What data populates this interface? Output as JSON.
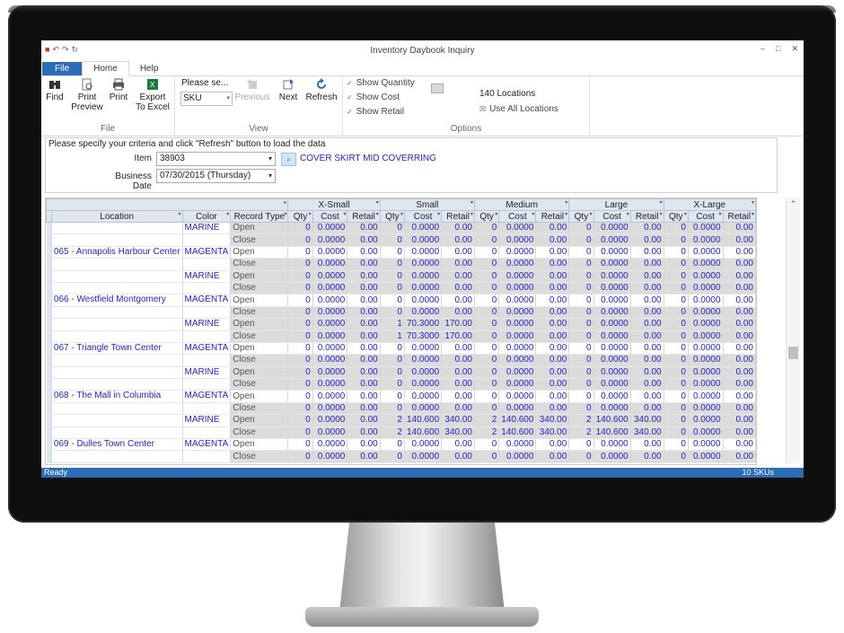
{
  "window": {
    "title": "Inventory Daybook Inquiry"
  },
  "tabs": [
    {
      "label": "File"
    },
    {
      "label": "Home"
    },
    {
      "label": "Help"
    }
  ],
  "ribbon": {
    "file_group": {
      "label": "File",
      "find": "Find",
      "print_preview": "Print Preview",
      "print": "Print",
      "export": "Export To Excel"
    },
    "view_group": {
      "label": "View",
      "please_select": "Please se...",
      "sku_value": "SKU",
      "previous": "Previous",
      "next": "Next",
      "refresh": "Refresh"
    },
    "options_group": {
      "label": "Options",
      "show_quantity": "Show Quantity",
      "show_cost": "Show Cost",
      "show_retail": "Show Retail",
      "locations_count": "140 Locations",
      "use_all_locations": "Use All Locations"
    }
  },
  "criteria": {
    "hint": "Please specify your criteria and click \"Refresh\" button to load the data",
    "item_label": "Item",
    "item_value": "38903",
    "item_description": "COVER SKIRT MID COVERRING",
    "date_label": "Business Date",
    "date_value": "07/30/2015 (Thursday)"
  },
  "grid": {
    "headers": {
      "location": "Location",
      "color": "Color",
      "record_type": "Record Type",
      "qty": "Qty",
      "cost": "Cost",
      "retail": "Retail"
    },
    "sizes": [
      "X-Small",
      "Small",
      "Medium",
      "Large",
      "X-Large"
    ],
    "rows": [
      {
        "loc": "",
        "color": "MARINE",
        "rt": "Open",
        "v": [
          [
            "0",
            "0.0000",
            "0.00"
          ],
          [
            "0",
            "0.0000",
            "0.00"
          ],
          [
            "0",
            "0.0000",
            "0.00"
          ],
          [
            "0",
            "0.0000",
            "0.00"
          ],
          [
            "0",
            "0.0000",
            "0.00"
          ]
        ]
      },
      {
        "loc": "",
        "color": "",
        "rt": "Close",
        "v": [
          [
            "0",
            "0.0000",
            "0.00"
          ],
          [
            "0",
            "0.0000",
            "0.00"
          ],
          [
            "0",
            "0.0000",
            "0.00"
          ],
          [
            "0",
            "0.0000",
            "0.00"
          ],
          [
            "0",
            "0.0000",
            "0.00"
          ]
        ]
      },
      {
        "loc": "065 - Annapolis Harbour Center",
        "color": "MAGENTA",
        "rt": "Open",
        "v": [
          [
            "0",
            "0.0000",
            "0.00"
          ],
          [
            "0",
            "0.0000",
            "0.00"
          ],
          [
            "0",
            "0.0000",
            "0.00"
          ],
          [
            "0",
            "0.0000",
            "0.00"
          ],
          [
            "0",
            "0.0000",
            "0.00"
          ]
        ]
      },
      {
        "loc": "",
        "color": "",
        "rt": "Close",
        "v": [
          [
            "0",
            "0.0000",
            "0.00"
          ],
          [
            "0",
            "0.0000",
            "0.00"
          ],
          [
            "0",
            "0.0000",
            "0.00"
          ],
          [
            "0",
            "0.0000",
            "0.00"
          ],
          [
            "0",
            "0.0000",
            "0.00"
          ]
        ]
      },
      {
        "loc": "",
        "color": "MARINE",
        "rt": "Open",
        "v": [
          [
            "0",
            "0.0000",
            "0.00"
          ],
          [
            "0",
            "0.0000",
            "0.00"
          ],
          [
            "0",
            "0.0000",
            "0.00"
          ],
          [
            "0",
            "0.0000",
            "0.00"
          ],
          [
            "0",
            "0.0000",
            "0.00"
          ]
        ]
      },
      {
        "loc": "",
        "color": "",
        "rt": "Close",
        "v": [
          [
            "0",
            "0.0000",
            "0.00"
          ],
          [
            "0",
            "0.0000",
            "0.00"
          ],
          [
            "0",
            "0.0000",
            "0.00"
          ],
          [
            "0",
            "0.0000",
            "0.00"
          ],
          [
            "0",
            "0.0000",
            "0.00"
          ]
        ]
      },
      {
        "loc": "066 - Westfield Montgomery",
        "color": "MAGENTA",
        "rt": "Open",
        "v": [
          [
            "0",
            "0.0000",
            "0.00"
          ],
          [
            "0",
            "0.0000",
            "0.00"
          ],
          [
            "0",
            "0.0000",
            "0.00"
          ],
          [
            "0",
            "0.0000",
            "0.00"
          ],
          [
            "0",
            "0.0000",
            "0.00"
          ]
        ]
      },
      {
        "loc": "",
        "color": "",
        "rt": "Close",
        "v": [
          [
            "0",
            "0.0000",
            "0.00"
          ],
          [
            "0",
            "0.0000",
            "0.00"
          ],
          [
            "0",
            "0.0000",
            "0.00"
          ],
          [
            "0",
            "0.0000",
            "0.00"
          ],
          [
            "0",
            "0.0000",
            "0.00"
          ]
        ]
      },
      {
        "loc": "",
        "color": "MARINE",
        "rt": "Open",
        "v": [
          [
            "0",
            "0.0000",
            "0.00"
          ],
          [
            "1",
            "70.3000",
            "170.00"
          ],
          [
            "0",
            "0.0000",
            "0.00"
          ],
          [
            "0",
            "0.0000",
            "0.00"
          ],
          [
            "0",
            "0.0000",
            "0.00"
          ]
        ]
      },
      {
        "loc": "",
        "color": "",
        "rt": "Close",
        "v": [
          [
            "0",
            "0.0000",
            "0.00"
          ],
          [
            "1",
            "70.3000",
            "170.00"
          ],
          [
            "0",
            "0.0000",
            "0.00"
          ],
          [
            "0",
            "0.0000",
            "0.00"
          ],
          [
            "0",
            "0.0000",
            "0.00"
          ]
        ]
      },
      {
        "loc": "067 - Triangle Town Center",
        "color": "MAGENTA",
        "rt": "Open",
        "v": [
          [
            "0",
            "0.0000",
            "0.00"
          ],
          [
            "0",
            "0.0000",
            "0.00"
          ],
          [
            "0",
            "0.0000",
            "0.00"
          ],
          [
            "0",
            "0.0000",
            "0.00"
          ],
          [
            "0",
            "0.0000",
            "0.00"
          ]
        ]
      },
      {
        "loc": "",
        "color": "",
        "rt": "Close",
        "v": [
          [
            "0",
            "0.0000",
            "0.00"
          ],
          [
            "0",
            "0.0000",
            "0.00"
          ],
          [
            "0",
            "0.0000",
            "0.00"
          ],
          [
            "0",
            "0.0000",
            "0.00"
          ],
          [
            "0",
            "0.0000",
            "0.00"
          ]
        ]
      },
      {
        "loc": "",
        "color": "MARINE",
        "rt": "Open",
        "v": [
          [
            "0",
            "0.0000",
            "0.00"
          ],
          [
            "0",
            "0.0000",
            "0.00"
          ],
          [
            "0",
            "0.0000",
            "0.00"
          ],
          [
            "0",
            "0.0000",
            "0.00"
          ],
          [
            "0",
            "0.0000",
            "0.00"
          ]
        ]
      },
      {
        "loc": "",
        "color": "",
        "rt": "Close",
        "v": [
          [
            "0",
            "0.0000",
            "0.00"
          ],
          [
            "0",
            "0.0000",
            "0.00"
          ],
          [
            "0",
            "0.0000",
            "0.00"
          ],
          [
            "0",
            "0.0000",
            "0.00"
          ],
          [
            "0",
            "0.0000",
            "0.00"
          ]
        ]
      },
      {
        "loc": "068 - The Mall in Columbia",
        "color": "MAGENTA",
        "rt": "Open",
        "v": [
          [
            "0",
            "0.0000",
            "0.00"
          ],
          [
            "0",
            "0.0000",
            "0.00"
          ],
          [
            "0",
            "0.0000",
            "0.00"
          ],
          [
            "0",
            "0.0000",
            "0.00"
          ],
          [
            "0",
            "0.0000",
            "0.00"
          ]
        ]
      },
      {
        "loc": "",
        "color": "",
        "rt": "Close",
        "v": [
          [
            "0",
            "0.0000",
            "0.00"
          ],
          [
            "0",
            "0.0000",
            "0.00"
          ],
          [
            "0",
            "0.0000",
            "0.00"
          ],
          [
            "0",
            "0.0000",
            "0.00"
          ],
          [
            "0",
            "0.0000",
            "0.00"
          ]
        ]
      },
      {
        "loc": "",
        "color": "MARINE",
        "rt": "Open",
        "v": [
          [
            "0",
            "0.0000",
            "0.00"
          ],
          [
            "2",
            "140.600",
            "340.00"
          ],
          [
            "2",
            "140.600",
            "340.00"
          ],
          [
            "2",
            "140.600",
            "340.00"
          ],
          [
            "0",
            "0.0000",
            "0.00"
          ]
        ]
      },
      {
        "loc": "",
        "color": "",
        "rt": "Close",
        "v": [
          [
            "0",
            "0.0000",
            "0.00"
          ],
          [
            "2",
            "140.600",
            "340.00"
          ],
          [
            "2",
            "140.600",
            "340.00"
          ],
          [
            "2",
            "140.600",
            "340.00"
          ],
          [
            "0",
            "0.0000",
            "0.00"
          ]
        ]
      },
      {
        "loc": "069 - Dulles Town Center",
        "color": "MAGENTA",
        "rt": "Open",
        "v": [
          [
            "0",
            "0.0000",
            "0.00"
          ],
          [
            "0",
            "0.0000",
            "0.00"
          ],
          [
            "0",
            "0.0000",
            "0.00"
          ],
          [
            "0",
            "0.0000",
            "0.00"
          ],
          [
            "0",
            "0.0000",
            "0.00"
          ]
        ]
      },
      {
        "loc": "",
        "color": "",
        "rt": "Close",
        "v": [
          [
            "0",
            "0.0000",
            "0.00"
          ],
          [
            "0",
            "0.0000",
            "0.00"
          ],
          [
            "0",
            "0.0000",
            "0.00"
          ],
          [
            "0",
            "0.0000",
            "0.00"
          ],
          [
            "0",
            "0.0000",
            "0.00"
          ]
        ]
      }
    ]
  },
  "status": {
    "left": "Ready",
    "right": "10 SKUs"
  },
  "colors": {
    "accent": "#2b6cb7",
    "link": "#2424c8",
    "header_bg": "#dfe6ef",
    "shade": "#dcdcdc"
  }
}
